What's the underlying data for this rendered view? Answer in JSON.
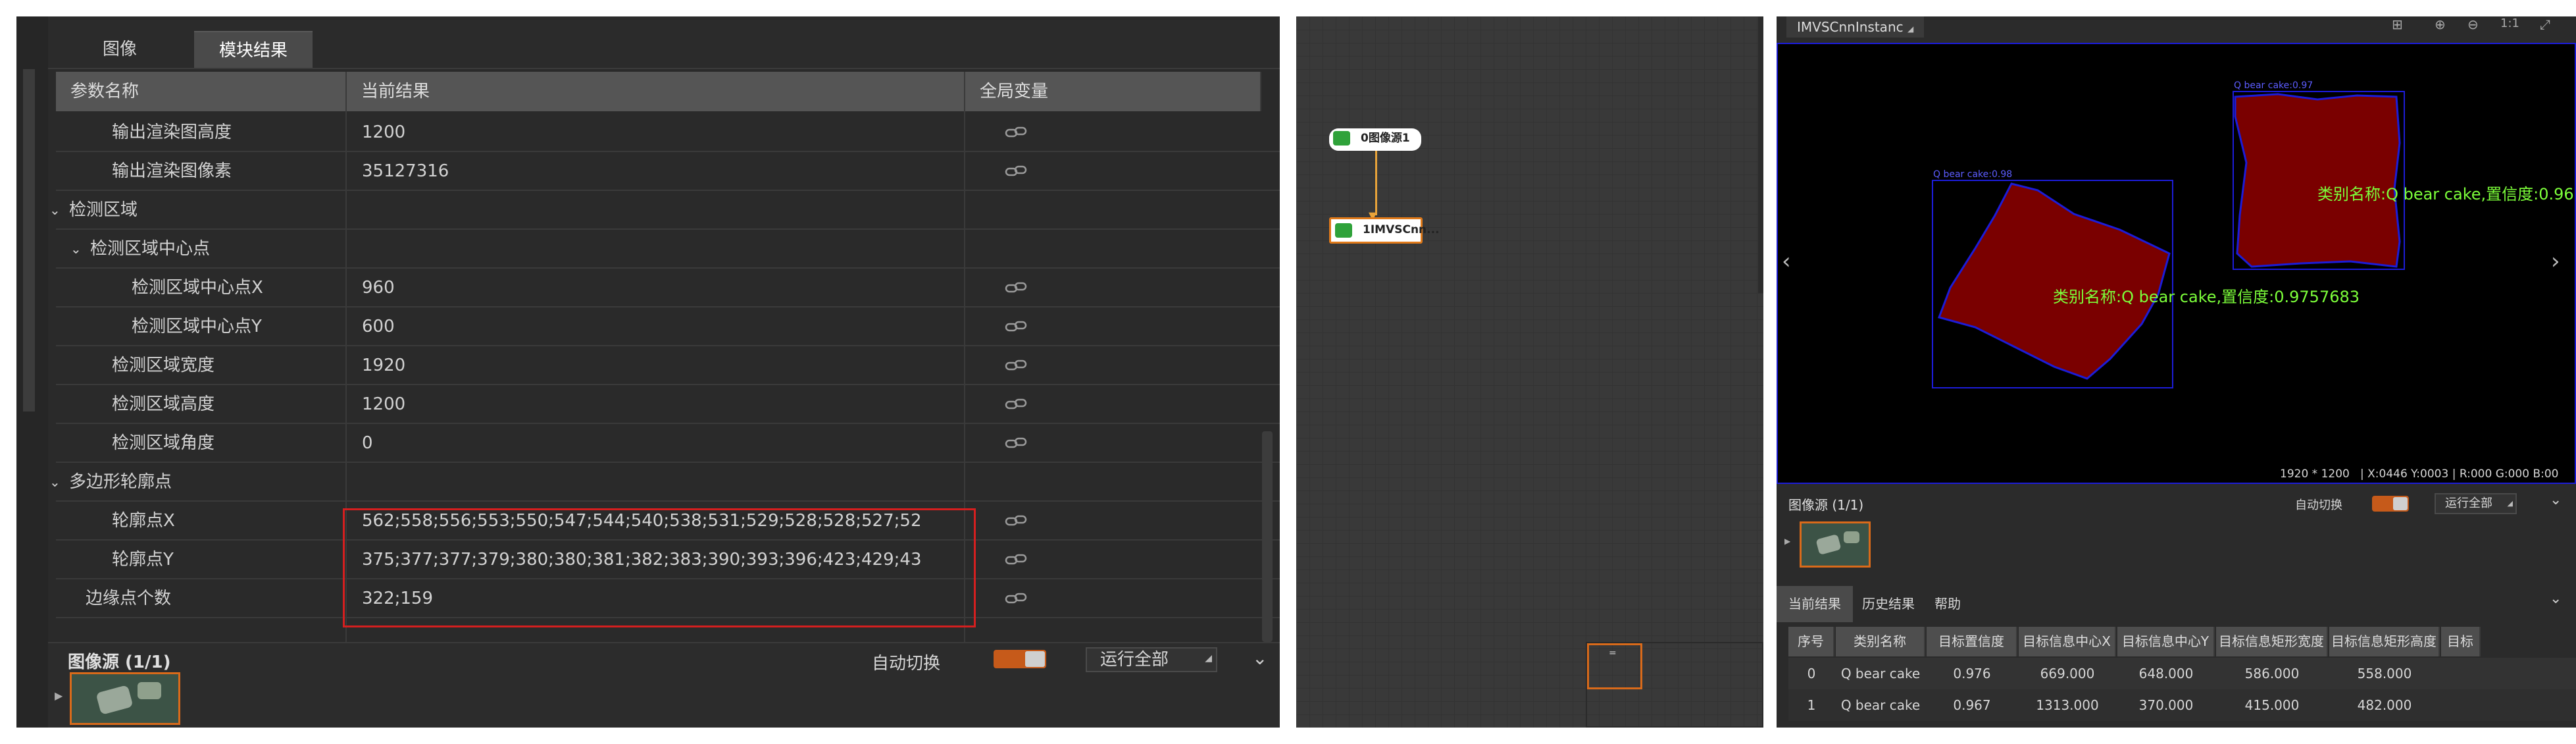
{
  "left": {
    "tabs": [
      "图像",
      "模块结果"
    ],
    "columns": [
      "参数名称",
      "当前结果",
      "全局变量"
    ],
    "rows": [
      {
        "name": "输出渲染图高度",
        "value": "1200",
        "link": true
      },
      {
        "name": "输出渲染图像素",
        "value": "35127316",
        "link": true
      },
      {
        "name": "检测区域",
        "value": "",
        "link": false
      },
      {
        "name": "检测区域中心点",
        "value": "",
        "link": false
      },
      {
        "name": "检测区域中心点X",
        "value": "960",
        "link": true
      },
      {
        "name": "检测区域中心点Y",
        "value": "600",
        "link": true
      },
      {
        "name": "检测区域宽度",
        "value": "1920",
        "link": true
      },
      {
        "name": "检测区域高度",
        "value": "1200",
        "link": true
      },
      {
        "name": "检测区域角度",
        "value": "0",
        "link": true
      },
      {
        "name": "多边形轮廓点",
        "value": "",
        "link": false
      },
      {
        "name": "轮廓点X",
        "value": "562;558;556;553;550;547;544;540;538;531;529;528;528;527;52",
        "link": true
      },
      {
        "name": "轮廓点Y",
        "value": "375;377;377;379;380;380;381;382;383;390;393;396;423;429;43",
        "link": true
      },
      {
        "name": "边缘点个数",
        "value": "322;159",
        "link": true
      }
    ],
    "bottom": {
      "source_label": "图像源 (1/1)",
      "auto_switch_label": "自动切换",
      "run_all_label": "运行全部"
    }
  },
  "center": {
    "node1_label": "0图像源1",
    "node2_label": "1IMVSCnn...",
    "minimap_label": "="
  },
  "right": {
    "title_tab": "IMVSCnnInstanc",
    "detections": [
      {
        "label": "Q bear cake:0.98",
        "text": "类别名称:Q bear cake,置信度:0.9757683"
      },
      {
        "label": "Q bear cake:0.97",
        "text": "类别名称:Q bear cake,置信度:0.96"
      }
    ],
    "statusbar": {
      "resolution": "1920 * 1200",
      "coords": "| X:0446 Y:0003 | R:000 G:000 B:00"
    },
    "source_label": "图像源 (1/1)",
    "auto_switch_label": "自动切换",
    "run_all_label": "运行全部",
    "result_tabs": [
      "当前结果",
      "历史结果",
      "帮助"
    ],
    "columns": [
      "序号",
      "类别名称",
      "目标置信度",
      "目标信息中心X",
      "目标信息中心Y",
      "目标信息矩形宽度",
      "目标信息矩形高度",
      "目标"
    ],
    "rows": [
      [
        "0",
        "Q bear cake",
        "0.976",
        "669.000",
        "648.000",
        "586.000",
        "558.000",
        ""
      ],
      [
        "1",
        "Q bear cake",
        "0.967",
        "1313.000",
        "370.000",
        "415.000",
        "482.000",
        ""
      ]
    ],
    "colors": {
      "detection_fill": "#7a0000",
      "detection_box": "#1c1cd8",
      "detection_text": "#7cff3a",
      "accent": "#c65a1a",
      "highlight": "#d41f1f"
    }
  }
}
